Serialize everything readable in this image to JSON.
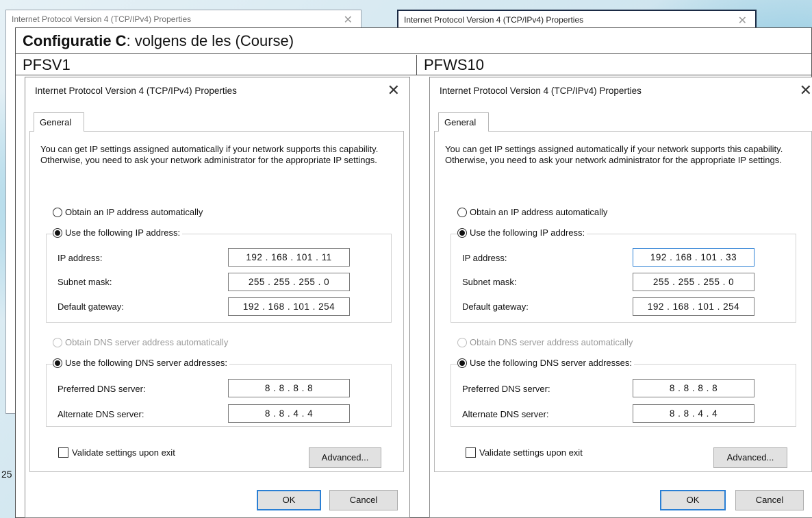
{
  "background": {
    "window1_title": "Internet Protocol Version 4 (TCP/IPv4) Properties",
    "window2_title": "Internet Protocol Version 4 (TCP/IPv4) Properties",
    "close_glyph": "✕"
  },
  "slide": {
    "title_bold": "Configuratie C",
    "title_rest": ": volgens de les (Course)",
    "stub_text": "25"
  },
  "columns": [
    {
      "header": "PFSV1",
      "dialog": {
        "title": "Internet Protocol Version 4 (TCP/IPv4) Properties",
        "close_glyph": "✕",
        "tab": "General",
        "intro": "You can get IP settings assigned automatically if your network supports this capability. Otherwise, you need to ask your network administrator for the appropriate IP settings.",
        "radio_auto_ip": "Obtain an IP address automatically",
        "radio_manual_ip": "Use the following IP address:",
        "ip_label": "IP address:",
        "ip_value": "192 . 168 . 101 . 11",
        "subnet_label": "Subnet mask:",
        "subnet_value": "255 . 255 . 255 . 0",
        "gateway_label": "Default gateway:",
        "gateway_value": "192 . 168 . 101 . 254",
        "radio_auto_dns": "Obtain DNS server address automatically",
        "radio_manual_dns": "Use the following DNS server addresses:",
        "pref_dns_label": "Preferred DNS server:",
        "pref_dns_value": "8 . 8 . 8 . 8",
        "alt_dns_label": "Alternate DNS server:",
        "alt_dns_value": "8 . 8 . 4 . 4",
        "validate_label": "Validate settings upon exit",
        "advanced": "Advanced...",
        "ok": "OK",
        "cancel": "Cancel"
      }
    },
    {
      "header": "PFWS10",
      "dialog": {
        "title": "Internet Protocol Version 4 (TCP/IPv4) Properties",
        "close_glyph": "✕",
        "tab": "General",
        "intro": "You can get IP settings assigned automatically if your network supports this capability. Otherwise, you need to ask your network administrator for the appropriate IP settings.",
        "radio_auto_ip": "Obtain an IP address automatically",
        "radio_manual_ip": "Use the following IP address:",
        "ip_label": "IP address:",
        "ip_value": "192 . 168 . 101 . 33",
        "subnet_label": "Subnet mask:",
        "subnet_value": "255 . 255 . 255 . 0",
        "gateway_label": "Default gateway:",
        "gateway_value": "192 . 168 . 101 . 254",
        "radio_auto_dns": "Obtain DNS server address automatically",
        "radio_manual_dns": "Use the following DNS server addresses:",
        "pref_dns_label": "Preferred DNS server:",
        "pref_dns_value": "8 . 8 . 8 . 8",
        "alt_dns_label": "Alternate DNS server:",
        "alt_dns_value": "8 . 8 . 4 . 4",
        "validate_label": "Validate settings upon exit",
        "advanced": "Advanced...",
        "ok": "OK",
        "cancel": "Cancel"
      }
    }
  ]
}
